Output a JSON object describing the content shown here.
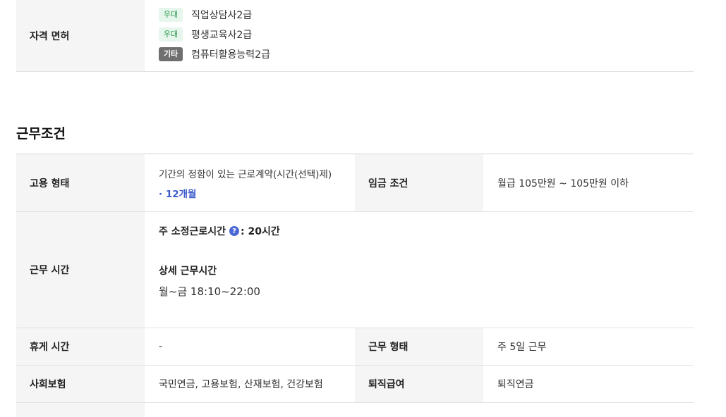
{
  "license": {
    "label": "자격 면허",
    "items": [
      {
        "badge": "우대",
        "name": "직업상담사2급"
      },
      {
        "badge": "우대",
        "name": "평생교육사2급"
      },
      {
        "badge": "기타",
        "name": "컴퓨터활용능력2급"
      }
    ]
  },
  "work_conditions": {
    "title": "근무조건",
    "employment": {
      "label": "고용 형태",
      "type": "기간의 정함이 있는 근로계약(시간(선택)제)",
      "period": "· 12개월"
    },
    "wage": {
      "label": "임금 조건",
      "value": "월급 105만원 ~ 105만원 이하"
    },
    "hours": {
      "label": "근무 시간",
      "weekly_label": "주 소정근로시간",
      "help_icon": "?",
      "weekly_value": ": 20시간",
      "detail_label": "상세 근무시간",
      "detail_value": "월~금 18:10~22:00"
    },
    "break": {
      "label": "휴게 시간",
      "value": "-"
    },
    "work_type": {
      "label": "근무 형태",
      "value": "주 5일 근무"
    },
    "insurance": {
      "label": "사회보험",
      "value": "국민연금, 고용보험, 산재보험, 건강보험"
    },
    "severance": {
      "label": "퇴직급여",
      "value": "퇴직연금"
    }
  },
  "colors": {
    "header_bg": "#f5f5f6",
    "pref_badge_bg": "#e7f6ec",
    "pref_badge_text": "#2b9a4f",
    "etc_badge_bg": "#6f6f6f",
    "accent_blue": "#3d5ccc"
  }
}
